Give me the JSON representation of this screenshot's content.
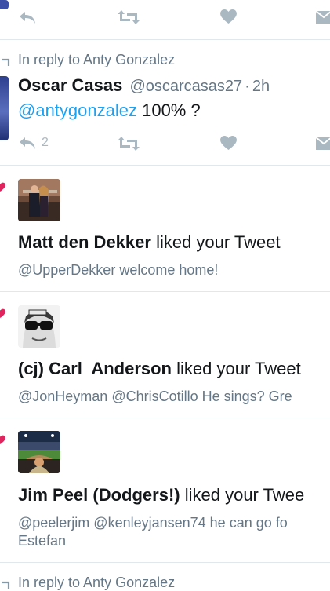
{
  "top_tweet_actions": {
    "reply_icon": "reply-icon",
    "retweet_icon": "retweet-icon",
    "like_icon": "heart-icon",
    "dm_icon": "envelope-icon"
  },
  "reply_tweet": {
    "in_reply_to": "In reply to Anty Gonzalez",
    "name": "Oscar Casas",
    "handle": "@oscarcasas27",
    "dot": "·",
    "time": "2h",
    "mention": "@antygonzalez",
    "text": " 100% ?",
    "reply_count": "2"
  },
  "notifications": [
    {
      "name": "Matt den Dekker",
      "action": " liked your Tweet",
      "snippet_line1": "@UpperDekker welcome home!",
      "snippet_line2": ""
    },
    {
      "name": "(cj) Carl  Anderson",
      "action": " liked your Tweet",
      "snippet_line1": "@JonHeyman @ChrisCotillo He sings? Gre",
      "snippet_line2": ""
    },
    {
      "name": "Jim Peel (Dodgers!)",
      "action": " liked your Twee",
      "snippet_line1": "@peelerjim @kenleyjansen74 he can go fo",
      "snippet_line2": "Estefan"
    }
  ],
  "bottom_reply": {
    "in_reply_to": "In reply to Anty Gonzalez"
  },
  "colors": {
    "accent": "#1da1f2",
    "like": "#e0245e",
    "muted": "#657786",
    "icon": "#aab8c2",
    "divider": "#e1e8ed"
  }
}
